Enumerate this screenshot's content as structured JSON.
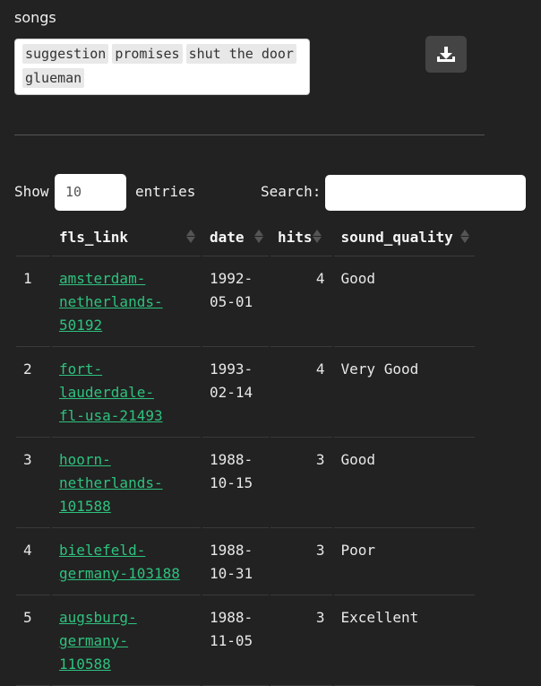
{
  "songs_label": "songs",
  "tags": [
    "suggestion",
    "promises",
    "shut the door",
    "glueman"
  ],
  "download_icon": "download-icon",
  "controls": {
    "show_label": "Show",
    "entries_value": "10",
    "entries_label": "entries",
    "search_label": "Search:",
    "search_value": ""
  },
  "table": {
    "columns": [
      "",
      "fls_link",
      "date",
      "hits",
      "sound_quality"
    ],
    "rows": [
      {
        "idx": "1",
        "link_lines": [
          "amsterdam-",
          "netherlands-50192"
        ],
        "date_lines": [
          "1992-",
          "05-01"
        ],
        "hits": "4",
        "sound_quality": "Good"
      },
      {
        "idx": "2",
        "link_lines": [
          "fort-lauderdale-",
          "fl-usa-21493"
        ],
        "date_lines": [
          "1993-",
          "02-14"
        ],
        "hits": "4",
        "sound_quality": "Very Good"
      },
      {
        "idx": "3",
        "link_lines": [
          "hoorn-",
          "netherlands-",
          "101588"
        ],
        "date_lines": [
          "1988-",
          "10-15"
        ],
        "hits": "3",
        "sound_quality": "Good"
      },
      {
        "idx": "4",
        "link_lines": [
          "bielefeld-",
          "germany-103188"
        ],
        "date_lines": [
          "1988-",
          "10-31"
        ],
        "hits": "3",
        "sound_quality": "Poor"
      },
      {
        "idx": "5",
        "link_lines": [
          "augsburg-germany-",
          "110588"
        ],
        "date_lines": [
          "1988-",
          "11-05"
        ],
        "hits": "3",
        "sound_quality": "Excellent"
      }
    ]
  },
  "colors": {
    "background": "#222222",
    "link": "#2ec27e",
    "button": "#444444"
  }
}
